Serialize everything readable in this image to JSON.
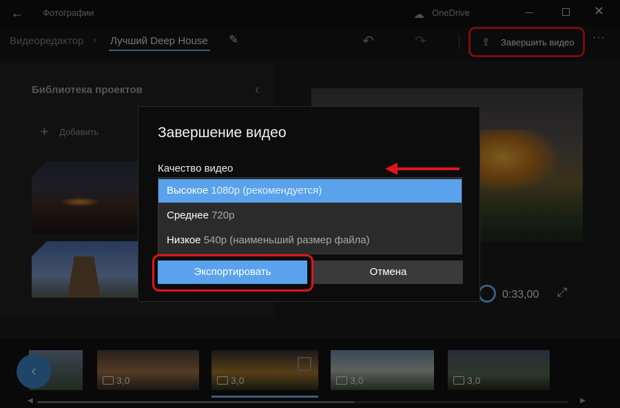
{
  "window": {
    "title": "Фотографии",
    "cloud_label": "OneDrive",
    "back_icon": "arrow-left-icon",
    "minimize_icon": "minimize-icon",
    "maximize_icon": "maximize-icon",
    "close_icon": "close-icon"
  },
  "header": {
    "breadcrumb_root": "Видеоредактор",
    "project_name": "Лучший Deep House",
    "finish_video_label": "Завершить видео",
    "more_label": "···",
    "accent_color": "#6aaee8"
  },
  "library": {
    "title": "Библиотека проектов",
    "add_label": "Добавить"
  },
  "player": {
    "time": "0:33,00"
  },
  "timeline": {
    "clips": [
      {
        "duration": ""
      },
      {
        "duration": "3,0"
      },
      {
        "duration": "3,0"
      },
      {
        "duration": "3,0"
      },
      {
        "duration": "3,0"
      }
    ]
  },
  "dialog": {
    "title": "Завершение видео",
    "quality_label": "Качество видео",
    "options": [
      {
        "main": "Высокое",
        "detail": "1080p (рекомендуется)",
        "selected": true
      },
      {
        "main": "Среднее",
        "detail": "720p",
        "selected": false
      },
      {
        "main": "Низкое",
        "detail": "540p (наименьший размер файла)",
        "selected": false
      }
    ],
    "export_label": "Экспортировать",
    "cancel_label": "Отмена",
    "highlight_color": "#e0151b"
  }
}
